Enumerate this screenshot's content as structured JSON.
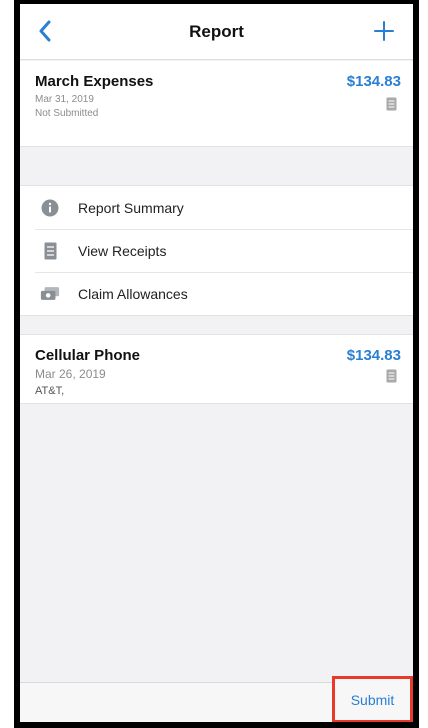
{
  "navbar": {
    "title": "Report",
    "back_icon": "chevron-left-icon",
    "add_icon": "plus-icon"
  },
  "report": {
    "name": "March Expenses",
    "date": "Mar 31, 2019",
    "status": "Not Submitted",
    "amount": "$134.83",
    "receipt_icon": "receipt-icon"
  },
  "menu": {
    "items": [
      {
        "label": "Report Summary",
        "icon": "info-icon"
      },
      {
        "label": "View Receipts",
        "icon": "receipt-icon"
      },
      {
        "label": "Claim Allowances",
        "icon": "allowance-icon"
      }
    ]
  },
  "expense": {
    "name": "Cellular Phone",
    "date": "Mar 26, 2019",
    "vendor": "AT&T,",
    "amount": "$134.83",
    "receipt_icon": "receipt-icon"
  },
  "toolbar": {
    "submit_label": "Submit"
  },
  "colors": {
    "accent": "#2a7fd4",
    "highlight": "#e8392a"
  }
}
